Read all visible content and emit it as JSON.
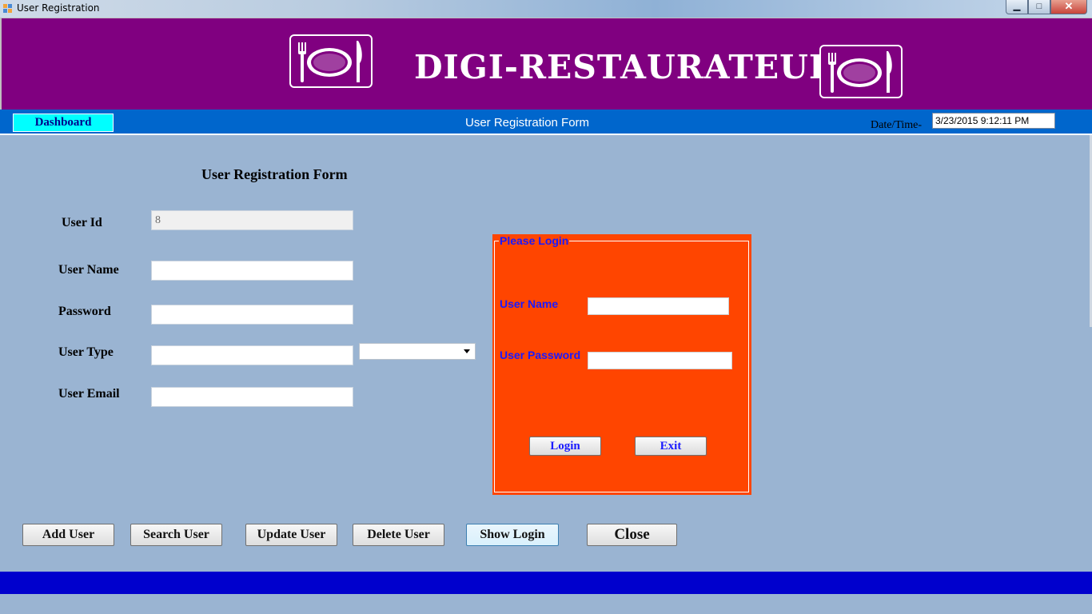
{
  "window": {
    "title": "User Registration",
    "controls": {
      "minimize": "▁",
      "maximize": "□",
      "close": "✕"
    }
  },
  "header": {
    "brand": "DIGI-RESTAURATEUR",
    "logo_icon": "plate-fork-knife-icon",
    "colors": {
      "background": "#800080",
      "text": "#ffffff"
    }
  },
  "nav": {
    "dashboard_label": "Dashboard",
    "title": "User Registration Form",
    "datetime_label": "Date/Time-",
    "datetime_value": "3/23/2015 9:12:11 PM",
    "colors": {
      "background": "#0066cc",
      "dashboard_button": "#00ffff"
    }
  },
  "form": {
    "title": "User Registration Form",
    "fields": {
      "user_id": {
        "label": "User Id",
        "value": "8"
      },
      "user_name": {
        "label": "User Name",
        "value": ""
      },
      "password": {
        "label": "Password",
        "value": ""
      },
      "user_type": {
        "label": "User Type",
        "value": ""
      },
      "user_email": {
        "label": "User Email",
        "value": ""
      }
    },
    "user_type_dropdown": {
      "selected": ""
    }
  },
  "login_panel": {
    "legend": "Please Login",
    "user_name_label": "User Name",
    "user_password_label": "User Password",
    "login_label": "Login",
    "exit_label": "Exit",
    "colors": {
      "background": "#ff4500",
      "label": "#1a1aff"
    }
  },
  "actions": {
    "add_user": "Add User",
    "search_user": "Search User",
    "update_user": "Update User",
    "delete_user": "Delete User",
    "show_login": "Show Login",
    "close": "Close"
  },
  "footer": {
    "color": "#0000cd"
  }
}
